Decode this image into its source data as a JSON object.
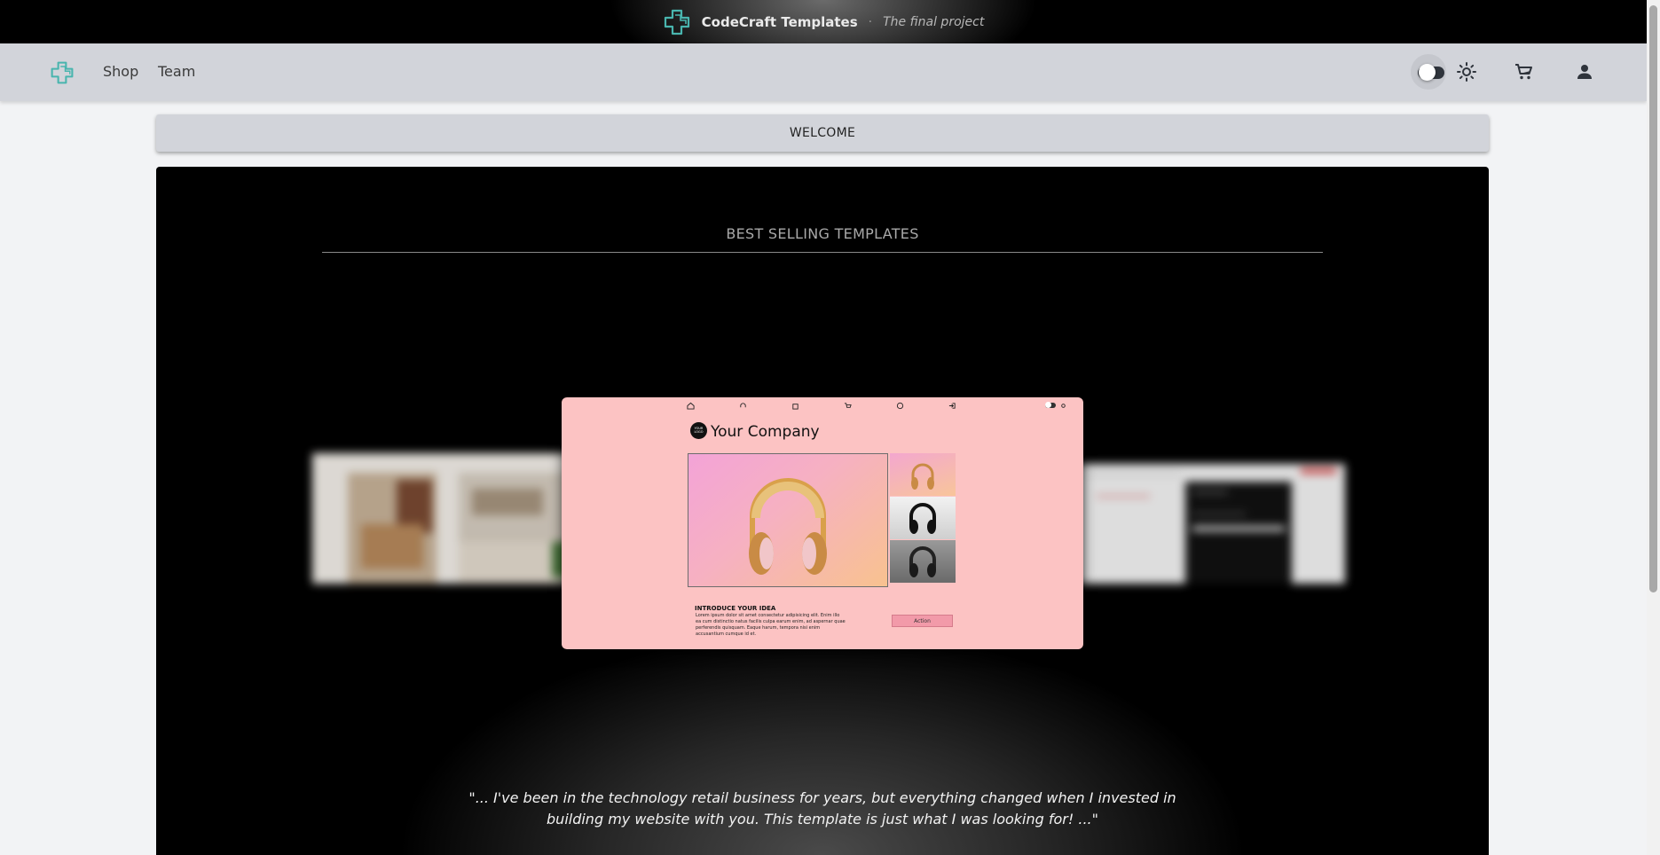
{
  "banner": {
    "brand": "CodeCraft Templates",
    "separator": "·",
    "tagline": "The final project"
  },
  "nav": {
    "links": [
      "Shop",
      "Team"
    ],
    "icons": [
      "theme-toggle",
      "sun-icon",
      "cart-icon",
      "user-icon"
    ]
  },
  "welcome": {
    "label": "WELCOME"
  },
  "showcase": {
    "title": "BEST SELLING TEMPLATES",
    "featured": {
      "company": "Your Company",
      "logo_text": "YOUR LOGO",
      "intro_heading": "INTRODUCE YOUR IDEA",
      "intro_text": "Lorem ipsum dolor sit amet consectetur adipisicing elit. Enim illo ea cum distinctio natus facilis culpa earum enim, ad aspernar quae perferendis quisquam. Eaque harum, tempora nisi enim accusantium cumque id et.",
      "action_label": "Action"
    },
    "testimonial": "\"... I've been in the technology retail business for years, but everything changed when I invested in building my website with you. This template is just what I was looking for! ...\""
  },
  "colors": {
    "accent": "#3fb7b0",
    "nav_bg": "#d2d4da",
    "card_bg": "#fcc3c3"
  }
}
